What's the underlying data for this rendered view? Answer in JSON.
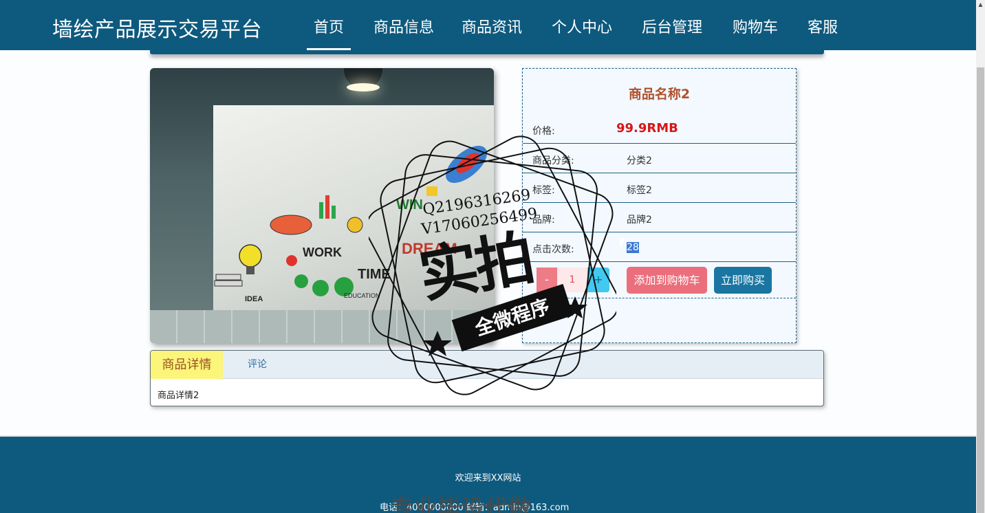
{
  "nav": {
    "brand": "墙绘产品展示交易平台",
    "items": [
      "首页",
      "商品信息",
      "商品资讯",
      "个人中心",
      "后台管理",
      "购物车",
      "客服"
    ],
    "active": "首页"
  },
  "product": {
    "name": "商品名称2",
    "price_label": "价格:",
    "price_value": "99.9RMB",
    "rows": [
      {
        "label": "商品分类:",
        "value": "分类2"
      },
      {
        "label": "标签:",
        "value": "标签2"
      },
      {
        "label": "品牌:",
        "value": "品牌2"
      },
      {
        "label": "点击次数:",
        "value": "28"
      }
    ],
    "quantity": "1",
    "minus": "-",
    "plus": "+",
    "add_to_cart": "添加到购物车",
    "buy_now": "立即购买"
  },
  "tabs": {
    "items": [
      "商品详情",
      "评论"
    ],
    "content": "商品详情2"
  },
  "footer": {
    "welcome": "欢迎来到XX网站",
    "contact": "电话：4000000000  邮箱：admin@163.com"
  },
  "watermark": {
    "phone1": "Q2196316269",
    "phone2": "V17060256499",
    "main": "实拍",
    "banner": "全微程序",
    "footer_text": "专业毕设代做"
  },
  "colors": {
    "nav_bg": "#0e5a7e",
    "price": "#d71717",
    "title": "#b0512c",
    "cart_button": "#ea6e7b",
    "buy_button": "#1a76a1",
    "tab_active": "#fbf57a"
  }
}
